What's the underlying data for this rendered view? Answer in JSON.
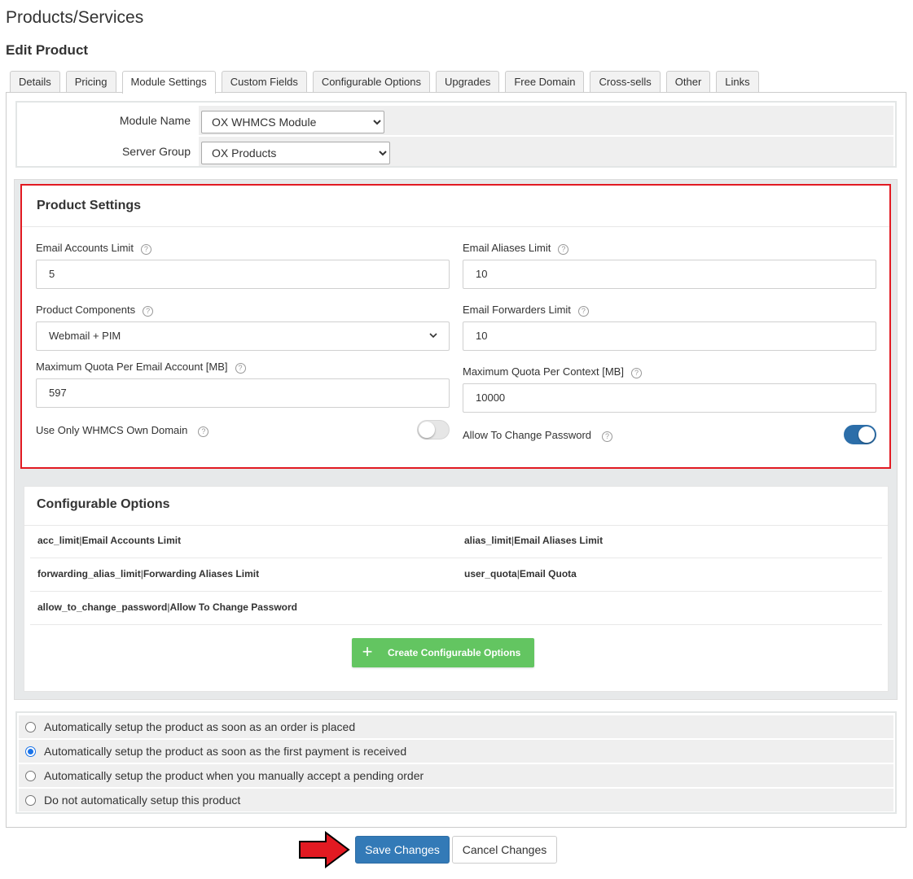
{
  "page": {
    "title": "Products/Services",
    "subtitle": "Edit Product"
  },
  "tabs": [
    {
      "label": "Details"
    },
    {
      "label": "Pricing"
    },
    {
      "label": "Module Settings",
      "active": true
    },
    {
      "label": "Custom Fields"
    },
    {
      "label": "Configurable Options"
    },
    {
      "label": "Upgrades"
    },
    {
      "label": "Free Domain"
    },
    {
      "label": "Cross-sells"
    },
    {
      "label": "Other"
    },
    {
      "label": "Links"
    }
  ],
  "module": {
    "module_name_label": "Module Name",
    "module_name_value": "OX WHMCS Module",
    "server_group_label": "Server Group",
    "server_group_value": "OX Products"
  },
  "product_settings": {
    "title": "Product Settings",
    "email_accounts_limit_label": "Email Accounts Limit",
    "email_accounts_limit_value": "5",
    "email_aliases_limit_label": "Email Aliases Limit",
    "email_aliases_limit_value": "10",
    "product_components_label": "Product Components",
    "product_components_value": "Webmail + PIM",
    "email_forwarders_limit_label": "Email Forwarders Limit",
    "email_forwarders_limit_value": "10",
    "max_quota_account_label": "Maximum Quota Per Email Account [MB]",
    "max_quota_account_value": "597",
    "max_quota_context_label": "Maximum Quota Per Context [MB]",
    "max_quota_context_value": "10000",
    "use_own_domain_label": "Use Only WHMCS Own Domain",
    "use_own_domain_on": false,
    "allow_change_password_label": "Allow To Change Password",
    "allow_change_password_on": true,
    "help_glyph": "?"
  },
  "configurable_options": {
    "title": "Configurable Options",
    "items": [
      {
        "name": "acc_limit",
        "label": "Email Accounts Limit"
      },
      {
        "name": "alias_limit",
        "label": "Email Aliases Limit"
      },
      {
        "name": "forwarding_alias_limit",
        "label": "Forwarding Aliases Limit"
      },
      {
        "name": "user_quota",
        "label": "Email Quota"
      },
      {
        "name": "allow_to_change_password",
        "label": "Allow To Change Password"
      }
    ],
    "separator": "|",
    "create_button_label": "Create Configurable Options",
    "create_button_icon": "plus-icon"
  },
  "setup_options": {
    "items": [
      {
        "label": "Automatically setup the product as soon as an order is placed",
        "checked": false
      },
      {
        "label": "Automatically setup the product as soon as the first payment is received",
        "checked": true
      },
      {
        "label": "Automatically setup the product when you manually accept a pending order",
        "checked": false
      },
      {
        "label": "Do not automatically setup this product",
        "checked": false
      }
    ]
  },
  "actions": {
    "save_label": "Save Changes",
    "cancel_label": "Cancel Changes"
  },
  "colors": {
    "primary": "#337ab7",
    "toggle_on": "#2c6ea9",
    "create_green": "#63c561",
    "highlight_red": "#e21a22"
  }
}
